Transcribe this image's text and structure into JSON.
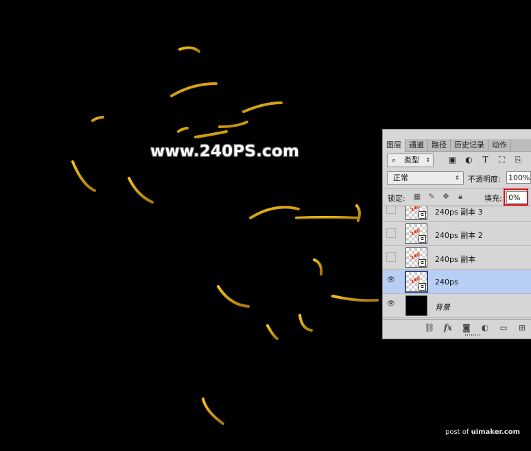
{
  "watermark": "www.240PS.com",
  "corner_credit": {
    "prefix": "post of ",
    "site": "uimaker.com"
  },
  "panel": {
    "tabs": [
      {
        "label": "图层",
        "active": true
      },
      {
        "label": "通道",
        "active": false
      },
      {
        "label": "路径",
        "active": false
      },
      {
        "label": "历史记录",
        "active": false
      },
      {
        "label": "动作",
        "active": false
      }
    ],
    "filter": {
      "icon": "search-icon",
      "label": "类型",
      "arrow": "⇕"
    },
    "filter_icons": [
      "image-filter-icon",
      "adjustment-filter-icon",
      "type-filter-icon",
      "shape-filter-icon",
      "smart-object-filter-icon"
    ],
    "blend_mode": "正常",
    "blend_arrow": "⇕",
    "opacity_label": "不透明度:",
    "opacity_value": "100%",
    "lock_label": "锁定:",
    "fill_label": "填充:",
    "fill_value": "0%",
    "layers": [
      {
        "name": "240ps 副本 3",
        "visible": false,
        "selected": false,
        "thumb": "smart",
        "partial": true
      },
      {
        "name": "240ps 副本 2",
        "visible": false,
        "selected": false,
        "thumb": "smart"
      },
      {
        "name": "240ps 副本",
        "visible": false,
        "selected": false,
        "thumb": "smart"
      },
      {
        "name": "240ps",
        "visible": true,
        "selected": true,
        "thumb": "smart"
      },
      {
        "name": "背景",
        "visible": true,
        "selected": false,
        "thumb": "black",
        "italic": true
      }
    ],
    "bottom_icons": [
      "link-icon",
      "fx-icon",
      "mask-icon",
      "adjustment-icon",
      "folder-icon",
      "new-layer-icon"
    ],
    "fx_label": "fx"
  },
  "colors": {
    "stroke_gold": "#d9a512",
    "selection_blue": "#b8cef5",
    "highlight_red": "#e01010"
  }
}
